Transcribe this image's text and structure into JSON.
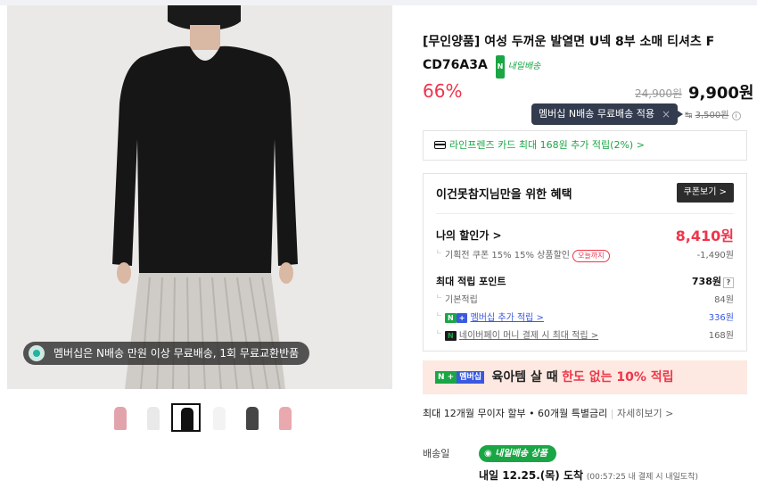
{
  "product": {
    "title": "[무인양품] 여성 두꺼운 발열면 U넥 8부 소매 티셔츠 F CD76A3A",
    "delivery_tag": "내일배송",
    "discount_rate": "66%",
    "original_price": "24,900원",
    "sale_price": "9,900원"
  },
  "shipping": {
    "tooltip": "멤버십 N배송 무료배송 적용",
    "tooltip_close": "×",
    "fee_icon_text": "↹",
    "fee_original": "3,500원",
    "info_icon": "i"
  },
  "card_promo": "라인프렌즈 카드 최대 168원 추가 적립(2%) >",
  "benefits": {
    "title": "이건못참지님만을 위한 혜택",
    "coupon_button": "쿠폰보기 >",
    "my_price_label": "나의 할인가 >",
    "my_price_value": "8,410원",
    "coupon_line": "기획전 쿠폰 15% 15% 상품할인",
    "coupon_tag": "오늘까지",
    "coupon_discount": "-1,490원",
    "points_label": "최대 적립 포인트",
    "points_value": "738원",
    "points_help": "?",
    "basic_label": "기본적립",
    "basic_value": "84원",
    "member_badge_n": "N",
    "member_badge_plus": "+",
    "member_label": "멤버십 추가 적립 >",
    "member_value": "336원",
    "pay_badge": "N",
    "pay_label": "네이버페이 머니 결제 시 최대 적립 >",
    "pay_value": "168원"
  },
  "banner": {
    "badge_n": "N +",
    "badge_plus": "멤버십",
    "text_1": "육아템 살 때",
    "text_2": "한도 없는 10% 적립"
  },
  "installment": {
    "text": "최대 12개월 무이자 할부 • 60개월 특별금리",
    "more": "자세히보기 >"
  },
  "delivery": {
    "label": "배송일",
    "badge": "내일배송 상품",
    "date": "내일 12.25.(목) 도착",
    "note": "(00:57:25 내 결제 시 내일도착)"
  },
  "gallery": {
    "promo": "멤버십은 N배송 만원 이상 무료배송, 1회 무료교환반품",
    "thumb_colors": [
      "#e2a4ac",
      "#e9e9e9",
      "#111111",
      "#f3f3f3",
      "#454545",
      "#e9a9ae"
    ]
  }
}
